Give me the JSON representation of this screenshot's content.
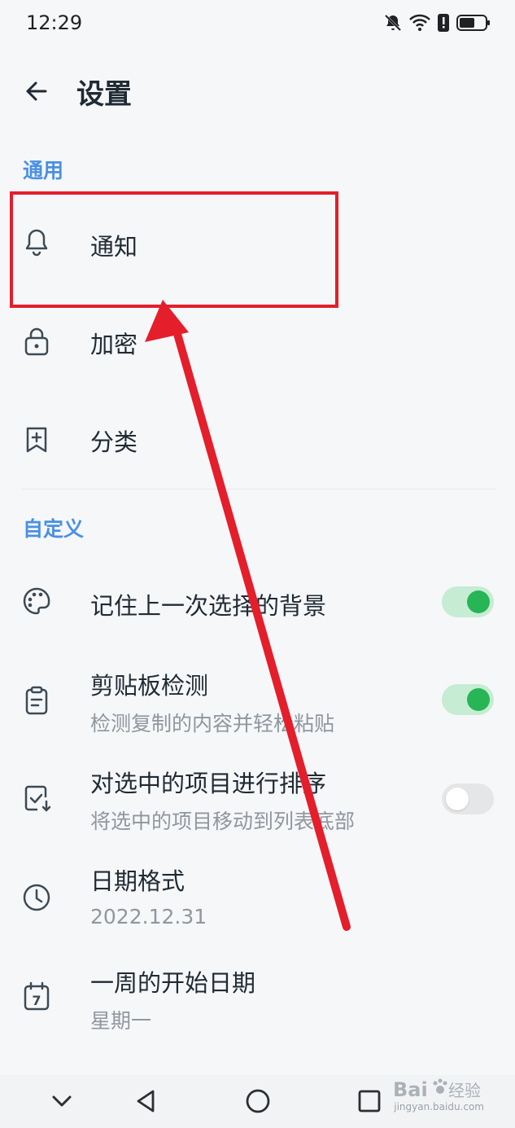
{
  "status_bar": {
    "time": "12:29",
    "icons": [
      "mute-icon",
      "wifi-icon",
      "alert-icon",
      "battery-icon"
    ]
  },
  "header": {
    "title": "设置",
    "back_icon": "arrow-left-icon"
  },
  "sections": {
    "general": {
      "label": "通用",
      "items": [
        {
          "title": "通知",
          "icon": "bell-icon"
        },
        {
          "title": "加密",
          "icon": "lock-icon"
        },
        {
          "title": "分类",
          "icon": "bookmark-plus-icon"
        }
      ]
    },
    "custom": {
      "label": "自定义",
      "items": [
        {
          "title": "记住上一次选择的背景",
          "icon": "palette-icon",
          "toggle": true
        },
        {
          "title": "剪贴板检测",
          "subtitle": "检测复制的内容并轻松粘贴",
          "icon": "clipboard-icon",
          "toggle": true
        },
        {
          "title": "对选中的项目进行排序",
          "subtitle": "将选中的项目移动到列表底部",
          "icon": "check-sort-icon",
          "toggle": false
        },
        {
          "title": "日期格式",
          "subtitle": "2022.12.31",
          "icon": "clock-icon"
        },
        {
          "title": "一周的开始日期",
          "subtitle": "星期一",
          "icon": "calendar-icon",
          "calendar_day": "7"
        }
      ]
    }
  },
  "annotation": {
    "highlight_color": "#e41e2b"
  },
  "nav_bar": {
    "buttons": [
      "chevron-down-icon",
      "back-triangle-icon",
      "home-circle-icon",
      "recents-square-icon"
    ]
  },
  "watermark": {
    "brand": "Bai",
    "suffix": "经验",
    "url": "jingyan.baidu.com"
  },
  "colors": {
    "accent": "#4a90e2",
    "toggle_on": "#27b556",
    "toggle_on_track": "#c6ecd3",
    "background": "#f6f7f9",
    "icon": "#3c4a55"
  }
}
